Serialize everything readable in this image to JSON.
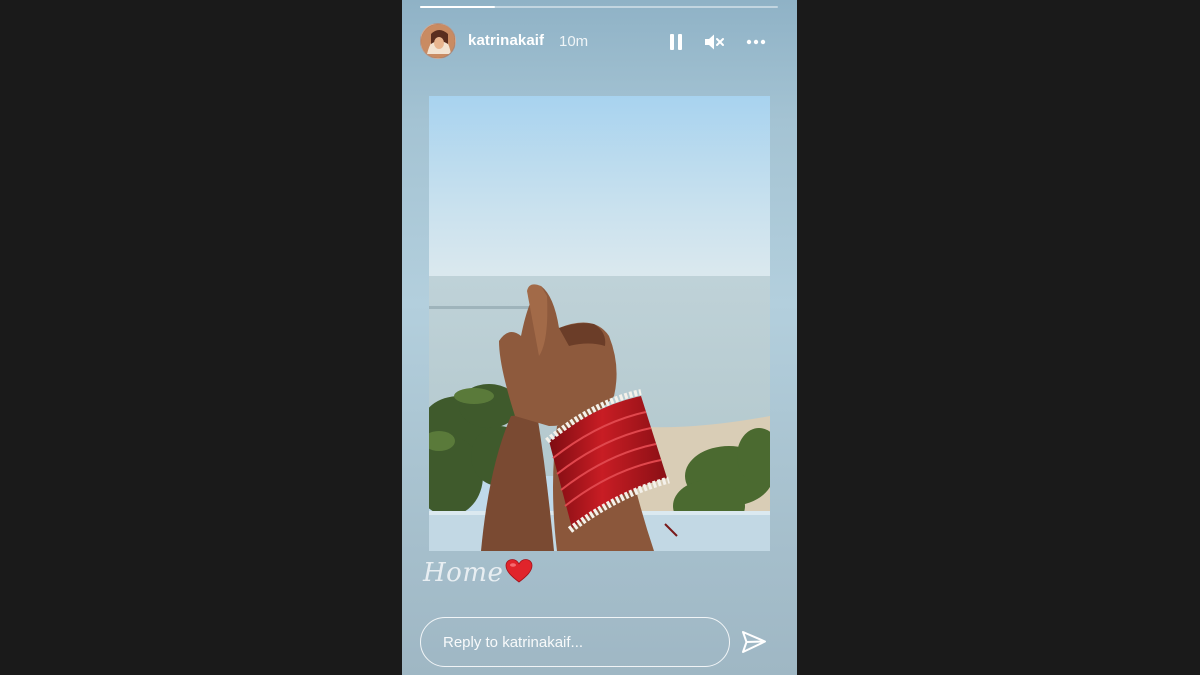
{
  "story": {
    "username": "katrinakaif",
    "time_ago": "10m",
    "progress": 0.21,
    "caption": "Home",
    "caption_emoji": "❤️",
    "reply_placeholder": "Reply to katrinakaif..."
  },
  "icons": {
    "pause": "pause-icon",
    "mute": "muted-speaker-icon",
    "more": "more-options-icon",
    "send": "send-paper-plane-icon"
  },
  "colors": {
    "page_background": "#1a1a1a",
    "story_background": "#a9c6d6",
    "text": "#ffffff",
    "bangles": "#b3161d"
  }
}
